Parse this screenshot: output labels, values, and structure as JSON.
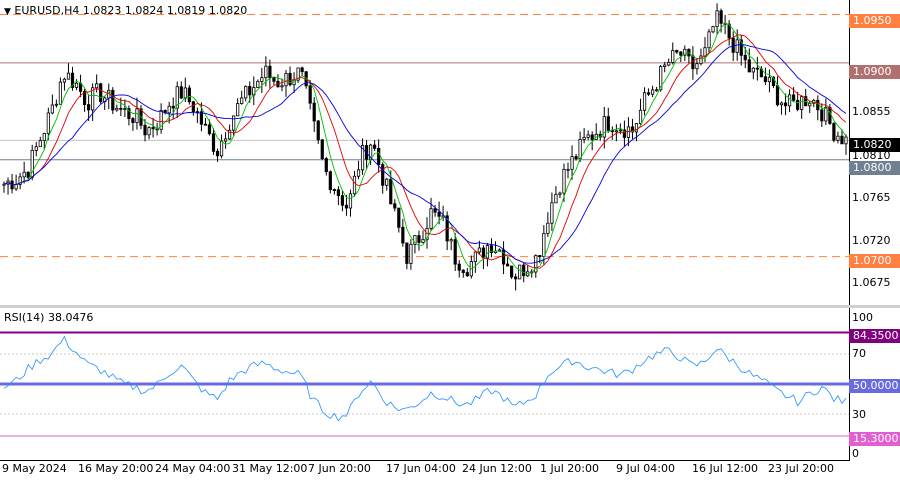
{
  "header": {
    "menu_glyph": "▼",
    "title": "EURUSD,H4",
    "ohlc": "1.0823 1.0824 1.0819 1.0820"
  },
  "main_pane": {
    "price_ticks": [
      "1.0855",
      "1.0810",
      "1.0765",
      "1.0720",
      "1.0675"
    ],
    "levels": [
      {
        "label": "1.0950",
        "style": "dashed",
        "color": "#ff8040"
      },
      {
        "label": "1.0900",
        "style": "solid",
        "color": "#b07070"
      },
      {
        "label": "1.0820",
        "style": "current",
        "color": "#000000"
      },
      {
        "label": "1.0800",
        "style": "solid",
        "color": "#708090"
      },
      {
        "label": "1.0700",
        "style": "dashed",
        "color": "#ff8040"
      }
    ]
  },
  "rsi_pane": {
    "title": "RSI(14) 38.0476",
    "ticks": [
      "100",
      "70",
      "30",
      "0"
    ],
    "levels": [
      {
        "label": "84.3500",
        "color": "#800080"
      },
      {
        "label": "50.0000",
        "color": "#6a6ae0"
      },
      {
        "label": "15.3000",
        "color": "#e060d0"
      }
    ]
  },
  "x_axis": {
    "labels": [
      "9 May 2024",
      "16 May 20:00",
      "24 May 04:00",
      "31 May 12:00",
      "7 Jun 20:00",
      "17 Jun 04:00",
      "24 Jun 12:00",
      "1 Jul 20:00",
      "9 Jul 04:00",
      "16 Jul 12:00",
      "23 Jul 20:00"
    ]
  },
  "colors": {
    "candle": "#000000",
    "ma_fast": "#00c000",
    "ma_mid": "#e00000",
    "ma_slow": "#0000e0",
    "rsi_line": "#1e90ff",
    "orange_level": "#ff8040",
    "current_price_tag": "#000000",
    "grey_level": "#708090"
  },
  "chart_data": {
    "type": "candlestick",
    "symbol": "EURUSD",
    "timeframe": "H4",
    "price_range": [
      1.065,
      1.0965
    ],
    "close_path": [
      1.0775,
      1.078,
      1.079,
      1.082,
      1.085,
      1.089,
      1.088,
      1.086,
      1.087,
      1.086,
      1.085,
      1.0845,
      1.083,
      1.084,
      1.086,
      1.087,
      1.0855,
      1.083,
      1.081,
      1.084,
      1.086,
      1.0875,
      1.089,
      1.088,
      1.0885,
      1.089,
      1.084,
      1.079,
      1.077,
      1.075,
      1.08,
      1.082,
      1.078,
      1.074,
      1.07,
      1.072,
      1.0745,
      1.0735,
      1.07,
      1.069,
      1.07,
      1.0715,
      1.0705,
      1.068,
      1.069,
      1.07,
      1.075,
      1.078,
      1.08,
      1.082,
      1.083,
      1.084,
      1.0835,
      1.083,
      1.086,
      1.088,
      1.09,
      1.091,
      1.0895,
      1.0905,
      1.0945,
      1.093,
      1.091,
      1.089,
      1.0885,
      1.087,
      1.0855,
      1.086,
      1.0865,
      1.085,
      1.083,
      1.082
    ],
    "rsi_path": [
      48,
      52,
      60,
      66,
      70,
      80,
      72,
      63,
      60,
      55,
      50,
      48,
      45,
      50,
      58,
      62,
      52,
      44,
      40,
      52,
      58,
      62,
      64,
      60,
      58,
      56,
      40,
      32,
      28,
      30,
      45,
      52,
      40,
      34,
      33,
      38,
      44,
      42,
      38,
      36,
      40,
      46,
      42,
      34,
      38,
      44,
      58,
      62,
      66,
      62,
      60,
      58,
      56,
      60,
      66,
      70,
      72,
      68,
      62,
      64,
      74,
      68,
      62,
      56,
      52,
      46,
      42,
      38,
      44,
      48,
      40,
      38
    ],
    "rsi_current": 38.0476,
    "rsi_range": [
      0,
      100
    ]
  }
}
